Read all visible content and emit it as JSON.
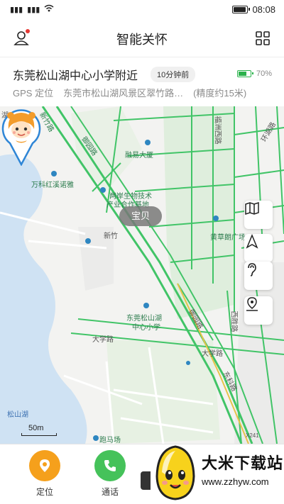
{
  "status_bar": {
    "signal_1": "⁴⁶",
    "signal_2": "⁴⁶",
    "time": "08:08"
  },
  "header": {
    "title": "智能关怀"
  },
  "location": {
    "place": "东莞松山湖中心小学附近",
    "time_ago": "10分钟前",
    "battery_level": 0.7,
    "battery_pct": "70%",
    "method": "GPS 定位",
    "address": "东莞市松山湖风景区翠竹路…",
    "accuracy": "(精度约15米)"
  },
  "map": {
    "baby_label": "宝贝",
    "scale_label": "50m",
    "labels": {
      "lake_road": "湖-1号",
      "xinzhu_road": "新竹路",
      "yuzhu_road": "御园路",
      "rongyi": "融易大厦",
      "wanke": "万科红溪诺雅",
      "liangan_1": "两岸生物技术",
      "liangan_2": "产业合作基地",
      "xinzhu_2": "新竹",
      "school_1": "东莞松山湖",
      "school_2": "中心小学",
      "daxue_road": "大学路",
      "daxue_road2": "大学路",
      "songshan_lake": "松山湖",
      "paoma": "跑马场",
      "huangcaolang": "黄草朗广场",
      "xisheng": "西胜路",
      "yuyuan2": "御园路",
      "fuxi": "福洲西路",
      "huanhu": "环湖路",
      "x241": "X241",
      "dongke": "东科路"
    }
  },
  "bottom_nav": {
    "locate_label": "定位",
    "call_label": "通话"
  },
  "watermark": {
    "title": "大米下载站",
    "url": "www.zzhyw.com"
  },
  "colors": {
    "road_green": "#41c467",
    "water": "#cfe2f3",
    "pin_blue": "#2f86d6",
    "locate_orange": "#f5a01c",
    "call_green": "#45c25a"
  }
}
